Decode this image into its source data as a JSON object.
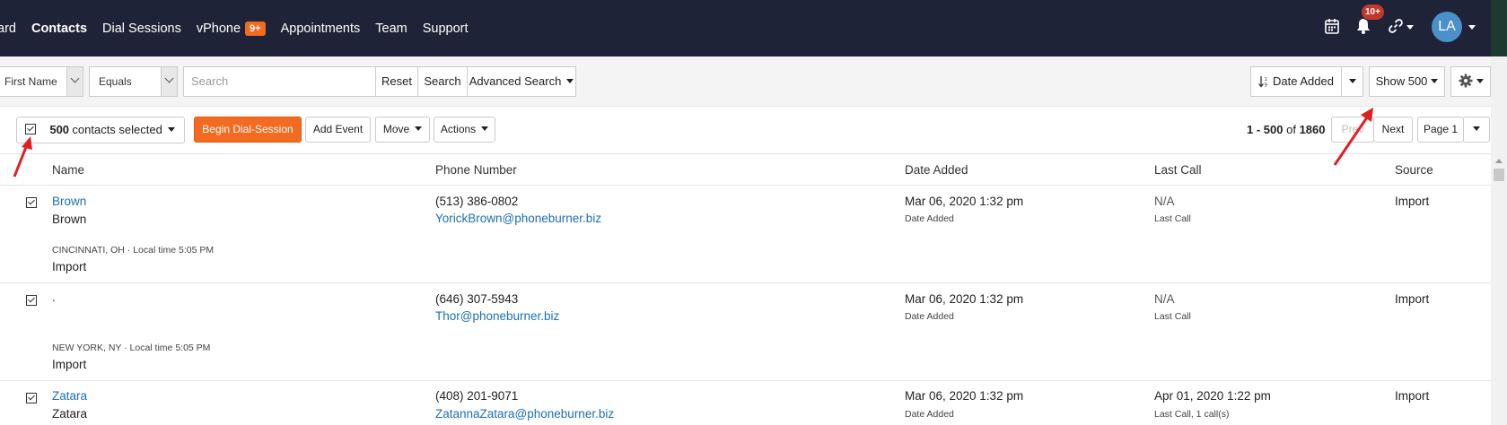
{
  "nav": {
    "items": [
      "ard",
      "Contacts",
      "Dial Sessions",
      "vPhone",
      "Appointments",
      "Team",
      "Support"
    ],
    "vphone_badge": "9+",
    "notifications_badge": "10+",
    "avatar_initials": "LA",
    "icons": [
      "calendar-icon",
      "bell-icon",
      "link-icon"
    ]
  },
  "filter": {
    "field": "First Name",
    "operator": "Equals",
    "search_placeholder": "Search",
    "reset_label": "Reset",
    "search_label": "Search",
    "advanced_label": "Advanced Search",
    "sort_label": "Date Added",
    "show_label": "Show 500",
    "settings_icon": "gear-icon"
  },
  "actions": {
    "selected_count": "500",
    "selected_suffix": "contacts selected",
    "begin_label": "Begin Dial-Session",
    "add_event_label": "Add Event",
    "move_label": "Move",
    "actions_label": "Actions",
    "range": "1 - 500",
    "range_of": "of",
    "total": "1860",
    "prev_label": "Prev",
    "next_label": "Next",
    "page_label": "Page 1"
  },
  "table": {
    "headers": [
      "Name",
      "Phone Number",
      "Date Added",
      "Last Call",
      "Source"
    ],
    "rows": [
      {
        "name_link": "Brown",
        "name_sub": "Brown",
        "location": "CINCINNATI, OH · Local time 5:05 PM",
        "location_source": "Import",
        "phone": "(513) 386-0802",
        "email": "YorickBrown@phoneburner.biz",
        "date_added": "Mar 06, 2020 1:32 pm",
        "date_added_label": "Date Added",
        "last_call": "N/A",
        "last_call_label": "Last Call",
        "source": "Import"
      },
      {
        "name_link": ".",
        "name_sub": "",
        "location": "NEW YORK, NY · Local time 5:05 PM",
        "location_source": "Import",
        "phone": "(646) 307-5943",
        "email": "Thor@phoneburner.biz",
        "date_added": "Mar 06, 2020 1:32 pm",
        "date_added_label": "Date Added",
        "last_call": "N/A",
        "last_call_label": "Last Call",
        "source": "Import"
      },
      {
        "name_link": "Zatara",
        "name_sub": "Zatara",
        "location": "",
        "location_source": "",
        "phone": "(408) 201-9071",
        "email": "ZatannaZatara@phoneburner.biz",
        "date_added": "Mar 06, 2020 1:32 pm",
        "date_added_label": "Date Added",
        "last_call": "Apr 01, 2020 1:22 pm",
        "last_call_label": "Last Call, 1 call(s)",
        "source": "Import"
      }
    ]
  },
  "colors": {
    "nav_bg": "#1f2338",
    "accent_orange": "#f26b21",
    "link_blue": "#1a6fb5",
    "annotation_red": "#e02020"
  }
}
